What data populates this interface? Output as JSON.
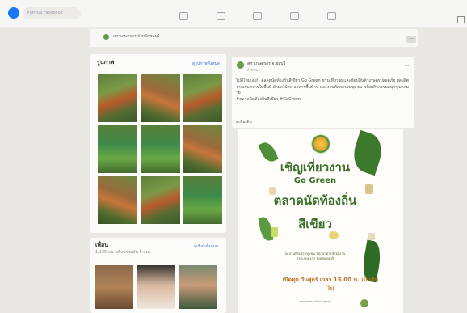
{
  "topbar": {
    "search_placeholder": "ค้นหาบน Facebook",
    "nav_icons": [
      "home-icon",
      "video-icon",
      "marketplace-icon",
      "groups-icon",
      "gaming-icon"
    ]
  },
  "page": {
    "name": "สภาเกษตรกร จังหวัดชลบุรี",
    "more_label": "···"
  },
  "photos": {
    "title": "รูปภาพ",
    "see_all": "ดูรูปภาพทั้งหมด"
  },
  "friends": {
    "title": "เพื่อน",
    "see_all": "ดูเพื่อนทั้งหมด",
    "count": "1,125 คน (เพื่อนร่วมกัน 6 คน)"
  },
  "post": {
    "author": "สภาเกษตรกร จ.ชลบุรี",
    "time": "2 ชั่วโมง",
    "text": "ไปดีไหมเอ่ย!! ตลาดนัดท้องถิ่นสีเขียว Go Green ชวนเที่ยวชมและช้อปสินค้าเกษตรปลอดภัย ผลผลิตจากเกษตรกรในพื้นที่ ผักผลไม้สด อาหารพื้นบ้าน และงานหัตถกรรมชุมชน พร้อมกิจกรรมสนุกๆ มากมาย",
    "hashtags": "#ตลาดนัดท้องถิ่นสีเขียว #GoGreen",
    "link": "ดูเพิ่มเติม"
  },
  "poster": {
    "line1": "เชิญเที่ยวงาน",
    "line2": "Go Green",
    "line3": "ตลาดนัดท้องถิ่น",
    "line4": "สีเขียว",
    "info": "ณ ลานกิจกรรมชุมชน หน้าอาคารสำนักงาน สภาเกษตรกร จังหวัดชลบุรี",
    "banner": "เปิดทุก วันศุกร์ เวลา 15.00 น. เป็นต้นไป",
    "footer": "สภาเกษตรกรจังหวัดชลบุรี"
  },
  "colors": {
    "brand": "#1877f2",
    "poster_green": "#3b6e2a",
    "poster_orange": "#c0691e",
    "link": "#4a7ad6"
  }
}
